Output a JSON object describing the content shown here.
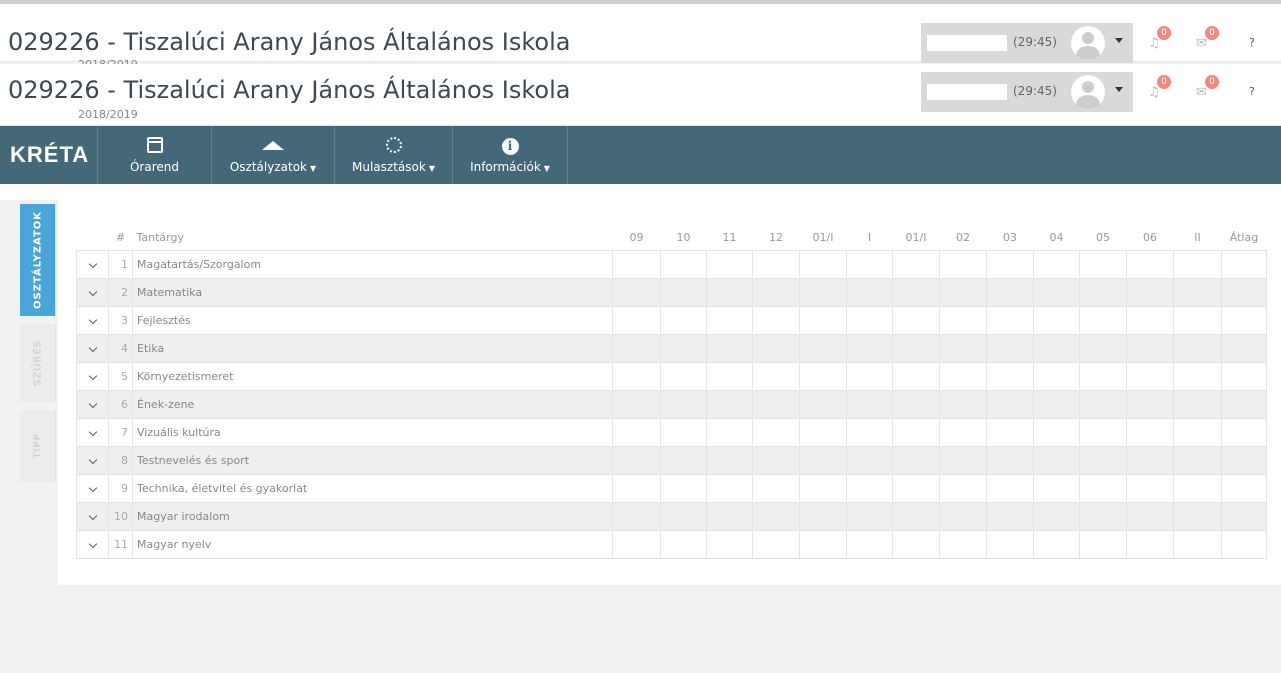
{
  "header": {
    "school_title": "029226 - Tiszalúci Arany János Általános Iskola",
    "school_year": "2018/2019",
    "session_timer": "(29:45)",
    "notifications_count": "0",
    "messages_count": "0",
    "help_label": "?"
  },
  "nav": {
    "logo": "KRÉTA",
    "items": [
      {
        "label": "Órarend",
        "icon": "calendar-check-icon",
        "dropdown": false
      },
      {
        "label": "Osztályzatok",
        "icon": "graduation-cap-icon",
        "dropdown": true
      },
      {
        "label": "Mulasztások",
        "icon": "spinner-icon",
        "dropdown": true
      },
      {
        "label": "Információk",
        "icon": "info-circle-icon",
        "dropdown": true
      }
    ]
  },
  "side_tabs": [
    "OSZTÁLYZATOK",
    "SZŰRÉS",
    "TIPP"
  ],
  "table": {
    "headers": {
      "num": "#",
      "subject": "Tantárgy",
      "months": [
        "09",
        "10",
        "11",
        "12",
        "01/I",
        "I",
        "01/I",
        "02",
        "03",
        "04",
        "05",
        "06",
        "II"
      ],
      "average": "Átlag"
    },
    "rows": [
      {
        "num": "1",
        "subject": "Magatartás/Szorgalom"
      },
      {
        "num": "2",
        "subject": "Matematika"
      },
      {
        "num": "3",
        "subject": "Fejlesztés"
      },
      {
        "num": "4",
        "subject": "Etika"
      },
      {
        "num": "5",
        "subject": "Környezetismeret"
      },
      {
        "num": "6",
        "subject": "Ének-zene"
      },
      {
        "num": "7",
        "subject": "Vizuális kultúra"
      },
      {
        "num": "8",
        "subject": "Testnevelés és sport"
      },
      {
        "num": "9",
        "subject": "Technika, életvitel és gyakorlat"
      },
      {
        "num": "10",
        "subject": "Magyar irodalom"
      },
      {
        "num": "11",
        "subject": "Magyar nyelv"
      }
    ]
  },
  "colors": {
    "navbar": "#456878",
    "active_tab": "#4aa6d8",
    "badge": "#f08a7e"
  }
}
